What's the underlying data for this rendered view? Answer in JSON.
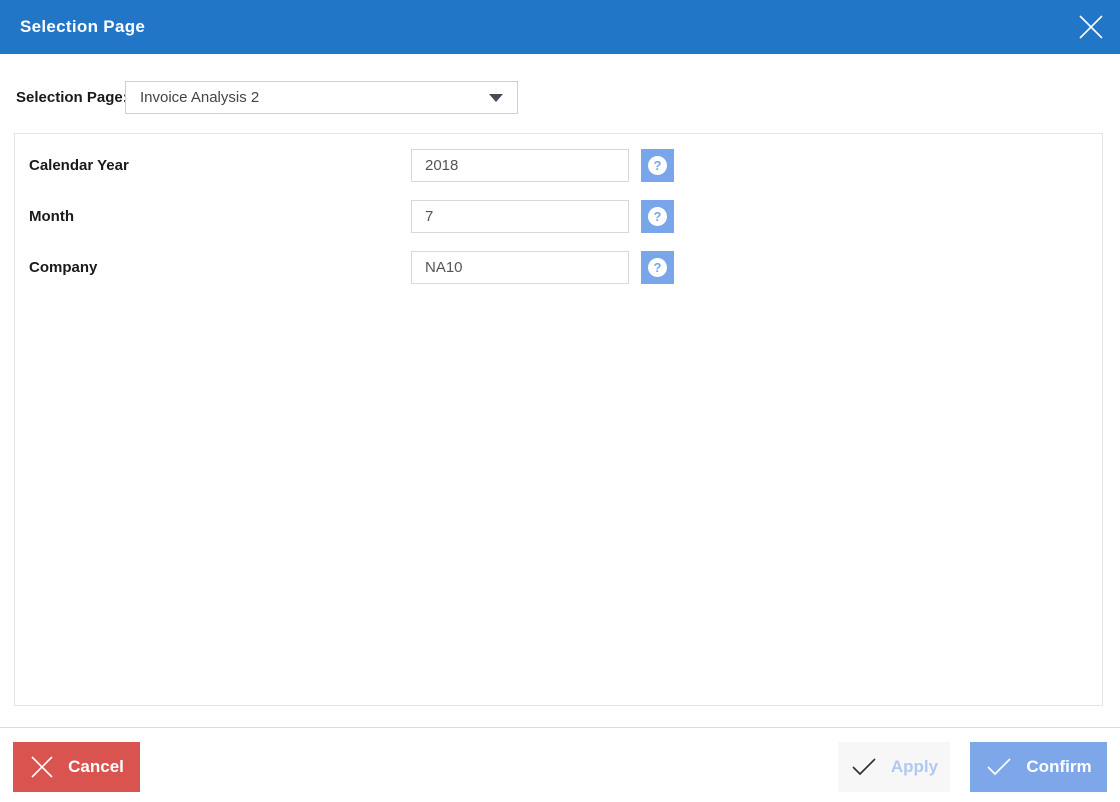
{
  "window": {
    "title": "Selection Page"
  },
  "selector": {
    "label": "Selection Page:",
    "value": "Invoice Analysis 2"
  },
  "form": {
    "fields": [
      {
        "label": "Calendar Year",
        "value": "2018"
      },
      {
        "label": "Month",
        "value": "7"
      },
      {
        "label": "Company",
        "value": "NA10"
      }
    ],
    "help_glyph": "?"
  },
  "footer": {
    "cancel": "Cancel",
    "apply": "Apply",
    "confirm": "Confirm"
  },
  "colors": {
    "header_bg": "#2176C7",
    "cancel_bg": "#D9534F",
    "confirm_bg": "#7DA7E9",
    "help_bg": "#79A5EA",
    "apply_bg": "#F7F7F7",
    "apply_text": "#AFC9F2",
    "label_text": "#1A1A1A",
    "input_text": "#555555"
  }
}
